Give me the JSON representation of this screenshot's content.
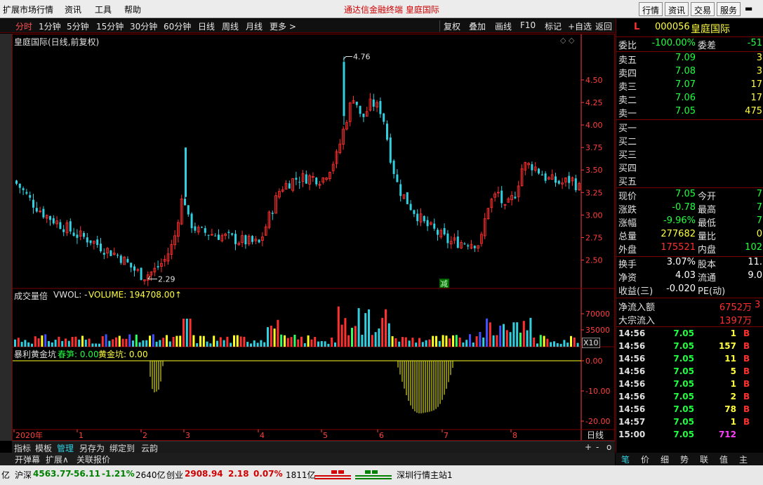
{
  "menubar": {
    "items": [
      "扩展市场行情",
      "资讯",
      "工具",
      "帮助"
    ],
    "app_title": "通达信金融终端  皇庭国际",
    "right_buttons": [
      "行情",
      "资讯",
      "交易",
      "服务"
    ]
  },
  "toolbar": {
    "periods": [
      "分时",
      "1分钟",
      "5分钟",
      "15分钟",
      "30分钟",
      "60分钟",
      "日线",
      "周线",
      "月线",
      "更多 >"
    ],
    "actions": [
      "复权",
      "叠加",
      "画线",
      "F10",
      "标记",
      "+自选",
      "返回"
    ]
  },
  "chart": {
    "title": "皇庭国际(日线,前复权)",
    "high_label": "4.76",
    "low_label": "2.29",
    "marker": "减",
    "price_ticks": [
      "4.50",
      "4.25",
      "4.00",
      "3.75",
      "3.50",
      "3.25",
      "3.00",
      "2.75",
      "2.50"
    ],
    "volume_header": {
      "name": "成交量倍",
      "vol": "VWOL: -",
      "volume": "VOLUME: 194708.00↑"
    },
    "volume_ticks": [
      "70000",
      "35000"
    ],
    "volume_unit": "X10",
    "indicator_header": {
      "name": "暴利黄金坑",
      "a": "春笋: 0.00",
      "b": "黄金坑: 0.00"
    },
    "indicator_ticks": [
      "0.00",
      "-10.00",
      "-20.00"
    ],
    "x_labels": [
      "2020年",
      "1",
      "2",
      "3",
      "4",
      "5",
      "6",
      "7",
      "8"
    ],
    "period_label": "日线",
    "colors": {
      "up": "#ff3030",
      "down": "#30d0e0",
      "yellow": "#ffff20",
      "axis": "#ff4040"
    }
  },
  "bottom_tabs": [
    "指标",
    "模板",
    "管理",
    "另存为",
    "绑定到",
    "云韵"
  ],
  "bottom_controls": [
    "+",
    "-",
    "o"
  ],
  "sub_tabs": [
    "开弹幕",
    "扩展∧",
    "关联报价"
  ],
  "quote": {
    "code_prefix": "L",
    "code": "000056",
    "name": "皇庭国际",
    "weibi_label": "委比",
    "weibi": "-100.00%",
    "weicha_label": "委差",
    "weicha": "-51",
    "asks": [
      {
        "label": "卖五",
        "price": "7.09",
        "vol": "3"
      },
      {
        "label": "卖四",
        "price": "7.08",
        "vol": "3"
      },
      {
        "label": "卖三",
        "price": "7.07",
        "vol": "17"
      },
      {
        "label": "卖二",
        "price": "7.06",
        "vol": "17"
      },
      {
        "label": "卖一",
        "price": "7.05",
        "vol": "475"
      }
    ],
    "bids": [
      {
        "label": "买一"
      },
      {
        "label": "买二"
      },
      {
        "label": "买三"
      },
      {
        "label": "买四"
      },
      {
        "label": "买五"
      }
    ],
    "stats": [
      {
        "k1": "现价",
        "v1": "7.05",
        "c1": "#20ff40",
        "k2": "今开",
        "v2": "7",
        "c2": "#20ff40"
      },
      {
        "k1": "涨跌",
        "v1": "-0.78",
        "c1": "#20ff40",
        "k2": "最高",
        "v2": "7",
        "c2": "#20ff40"
      },
      {
        "k1": "涨幅",
        "v1": "-9.96%",
        "c1": "#20ff40",
        "k2": "最低",
        "v2": "7",
        "c2": "#20ff40"
      },
      {
        "k1": "总量",
        "v1": "277682",
        "c1": "#ffff40",
        "k2": "量比",
        "v2": "0",
        "c2": "#ffff40"
      },
      {
        "k1": "外盘",
        "v1": "175521",
        "c1": "#ff3030",
        "k2": "内盘",
        "v2": "102",
        "c2": "#20ff40"
      }
    ],
    "stats2": [
      {
        "k1": "换手",
        "v1": "3.07%",
        "k2": "股本",
        "v2": "11."
      },
      {
        "k1": "净资",
        "v1": "4.03",
        "k2": "流通",
        "v2": "9.0"
      },
      {
        "k1": "收益(三)",
        "v1": "-0.020",
        "k2": "PE(动)",
        "v2": ""
      }
    ],
    "flow": [
      {
        "k": "净流入额",
        "v": "6752万",
        "v2": "3"
      },
      {
        "k": "大宗流入",
        "v": "1397万",
        "v2": ""
      }
    ],
    "ticks": [
      {
        "t": "14:56",
        "p": "7.05",
        "v": "1",
        "f": "B",
        "vc": "#ffff40"
      },
      {
        "t": "14:56",
        "p": "7.05",
        "v": "157",
        "f": "B",
        "vc": "#ffff40"
      },
      {
        "t": "14:56",
        "p": "7.05",
        "v": "11",
        "f": "B",
        "vc": "#ffff40"
      },
      {
        "t": "14:56",
        "p": "7.05",
        "v": "5",
        "f": "B",
        "vc": "#ffff40"
      },
      {
        "t": "14:56",
        "p": "7.05",
        "v": "1",
        "f": "B",
        "vc": "#ffff40"
      },
      {
        "t": "14:56",
        "p": "7.05",
        "v": "2",
        "f": "B",
        "vc": "#ffff40"
      },
      {
        "t": "14:56",
        "p": "7.05",
        "v": "78",
        "f": "B",
        "vc": "#ffff40"
      },
      {
        "t": "14:57",
        "p": "7.05",
        "v": "1",
        "f": "B",
        "vc": "#ffff40"
      },
      {
        "t": "15:00",
        "p": "7.05",
        "v": "712",
        "f": "",
        "vc": "#ff40ff"
      }
    ],
    "tabs": [
      "笔",
      "价",
      "细",
      "势",
      "联",
      "值",
      "主"
    ]
  },
  "status": {
    "left": "亿",
    "hushen_label": "沪深",
    "hushen_val": "4563.77",
    "hushen_chg": "-56.11",
    "hushen_pct": "-1.21%",
    "hushen_amt": "2640亿",
    "chuangye_label": "创业",
    "chuangye_val": "2908.94",
    "chuangye_chg": "2.18",
    "chuangye_pct": "0.07%",
    "chuangye_amt": "1811亿",
    "server": "深圳行情主站1"
  }
}
